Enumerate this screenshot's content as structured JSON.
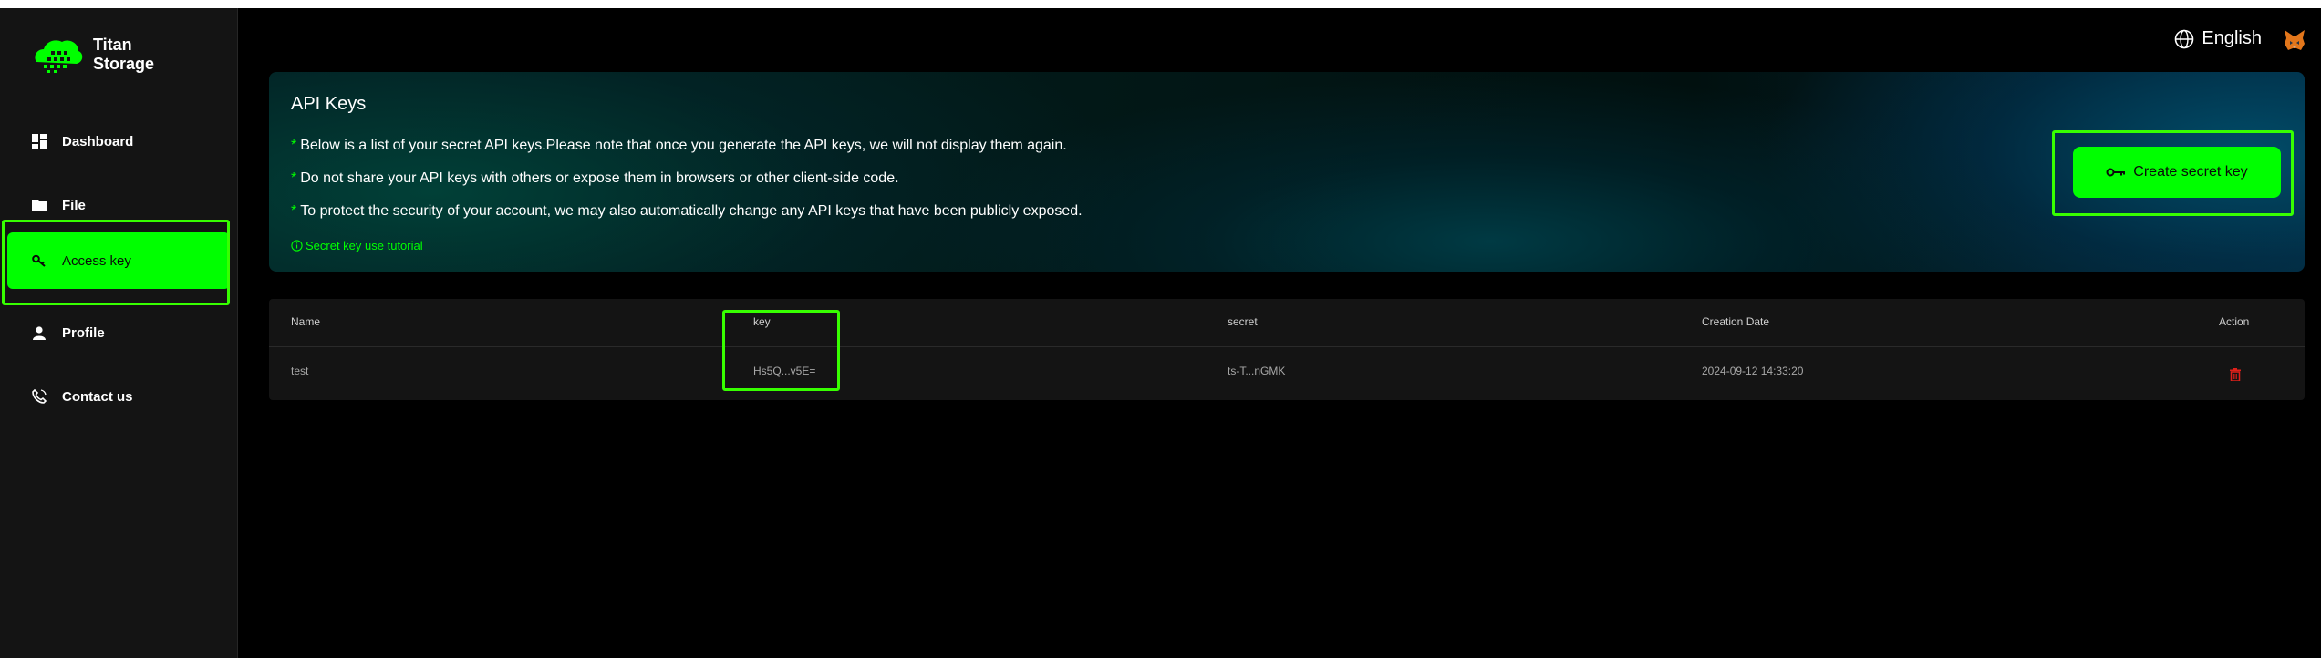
{
  "app": {
    "logo_line1": "Titan",
    "logo_line2": "Storage",
    "accent_color": "#00ff00",
    "highlight_color": "#37ff00"
  },
  "sidebar": {
    "items": [
      {
        "label": "Dashboard",
        "icon": "dashboard-icon",
        "active": false
      },
      {
        "label": "File",
        "icon": "folder-icon",
        "active": false
      },
      {
        "label": "Access key",
        "icon": "key-icon",
        "active": true
      },
      {
        "label": "Profile",
        "icon": "user-icon",
        "active": false
      },
      {
        "label": "Contact us",
        "icon": "phone-icon",
        "active": false
      }
    ]
  },
  "header": {
    "language": "English",
    "language_icon": "globe-icon",
    "wallet_icon": "metamask-fox-icon"
  },
  "banner": {
    "title": "API Keys",
    "notes": [
      "Below is a list of your secret API keys.Please note that once you generate the API keys, we will not display them again.",
      "Do not share your API keys with others or expose them in browsers or other client-side code.",
      "To protect the security of your account, we may also automatically change any API keys that have been publicly exposed."
    ],
    "note_marker": "*",
    "tutorial_link": "Secret key use tutorial",
    "create_button": "Create secret key"
  },
  "table": {
    "columns": [
      "Name",
      "key",
      "secret",
      "Creation Date",
      "Action"
    ],
    "rows": [
      {
        "name": "test",
        "key": "Hs5Q...v5E=",
        "secret": "ts-T...nGMK",
        "date": "2024-09-12 14:33:20",
        "action_icon": "trash-icon",
        "action_color": "#e0201a"
      }
    ]
  }
}
